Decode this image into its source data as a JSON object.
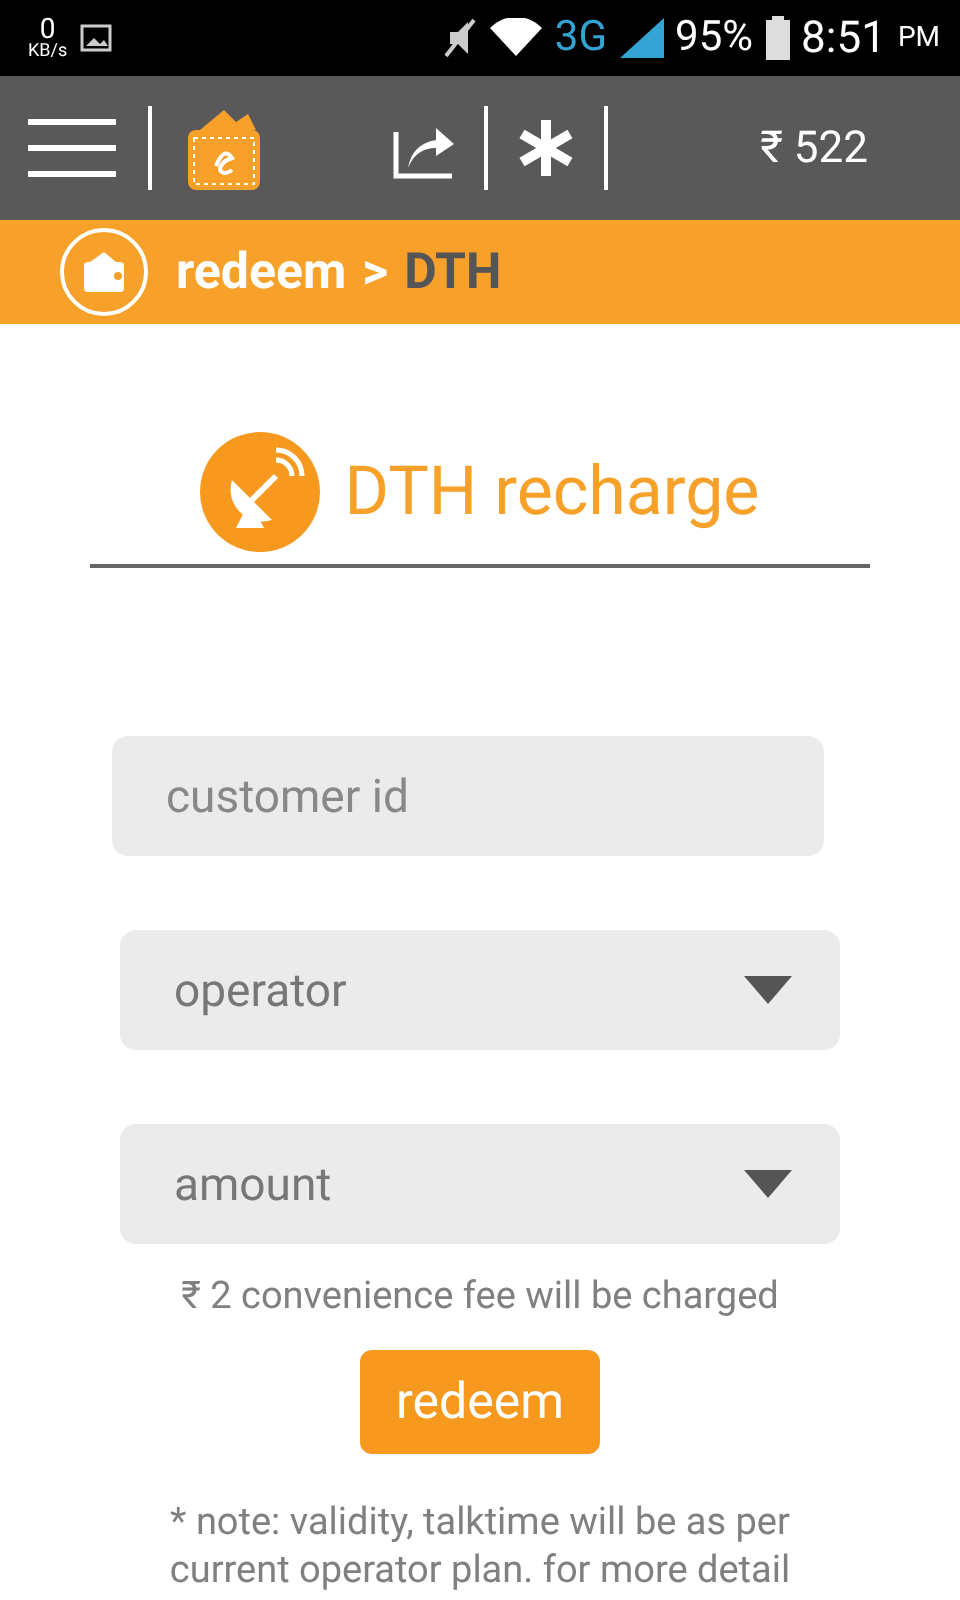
{
  "status_bar": {
    "speed_value": "0",
    "speed_unit": "KB/s",
    "network": "3G",
    "battery": "95%",
    "time": "8:51",
    "time_suffix": "PM"
  },
  "toolbar": {
    "balance": "₹ 522"
  },
  "breadcrumb": {
    "parent": "redeem",
    "separator": ">",
    "current": "DTH"
  },
  "heading": "DTH recharge",
  "fields": [
    {
      "kind": "input",
      "placeholder": "customer id"
    },
    {
      "kind": "select",
      "placeholder": "operator"
    },
    {
      "kind": "select",
      "placeholder": "amount"
    }
  ],
  "fee_note": "₹ 2 convenience fee will be charged",
  "button": "redeem",
  "note": "* note: validity, talktime will be as per current operator plan. for more detail"
}
